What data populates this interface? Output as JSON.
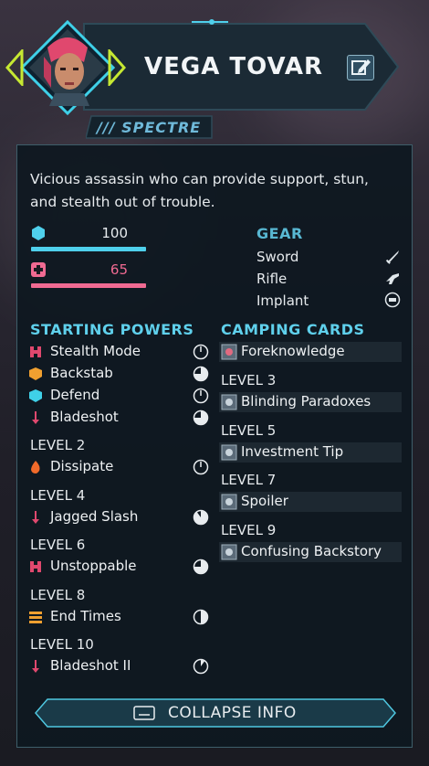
{
  "character": {
    "name": "VEGA TOVAR",
    "class_name": "/// SPECTRE",
    "description": "Vicious assassin who can provide support, stun, and stealth out of trouble."
  },
  "stats": {
    "shield": {
      "value": "100",
      "fill": 1.0,
      "color": "#4fd0ec",
      "icon": "shield-icon"
    },
    "health": {
      "value": "65",
      "fill": 1.0,
      "color": "#f06a92",
      "icon": "health-cross-icon"
    }
  },
  "gear": {
    "heading": "GEAR",
    "items": [
      {
        "label": "Sword",
        "icon": "sword-icon"
      },
      {
        "label": "Rifle",
        "icon": "rifle-icon"
      },
      {
        "label": "Implant",
        "icon": "implant-icon"
      }
    ]
  },
  "powers": {
    "heading": "STARTING POWERS",
    "starting": [
      {
        "label": "Stealth Mode",
        "icon": "stealth-mode-icon",
        "cooldown": 0
      },
      {
        "label": "Backstab",
        "icon": "backstab-icon",
        "cooldown": 0.75
      },
      {
        "label": "Defend",
        "icon": "defend-icon",
        "cooldown": 0
      },
      {
        "label": "Bladeshot",
        "icon": "bladeshot-icon",
        "cooldown": 0.75
      }
    ],
    "levels": [
      {
        "level": "LEVEL 2",
        "label": "Dissipate",
        "icon": "dissipate-icon",
        "cooldown": 0
      },
      {
        "level": "LEVEL 4",
        "label": "Jagged Slash",
        "icon": "jagged-slash-icon",
        "cooldown": 0.9
      },
      {
        "level": "LEVEL 6",
        "label": "Unstoppable",
        "icon": "unstoppable-icon",
        "cooldown": 0.75
      },
      {
        "level": "LEVEL 8",
        "label": "End Times",
        "icon": "end-times-icon",
        "cooldown": 0.5
      },
      {
        "level": "LEVEL 10",
        "label": "Bladeshot II",
        "icon": "bladeshot-ii-icon",
        "cooldown": 0.1
      }
    ]
  },
  "camping": {
    "heading": "CAMPING CARDS",
    "first": {
      "label": "Foreknowledge",
      "icon": "foreknowledge-card-icon"
    },
    "levels": [
      {
        "level": "LEVEL 3",
        "label": "Blinding Paradoxes",
        "icon": "blinding-paradoxes-card-icon"
      },
      {
        "level": "LEVEL 5",
        "label": "Investment Tip",
        "icon": "investment-tip-card-icon"
      },
      {
        "level": "LEVEL 7",
        "label": "Spoiler",
        "icon": "spoiler-card-icon"
      },
      {
        "level": "LEVEL 9",
        "label": "Confusing Backstory",
        "icon": "confusing-backstory-card-icon"
      }
    ]
  },
  "footer": {
    "collapse_label": "COLLAPSE INFO"
  }
}
